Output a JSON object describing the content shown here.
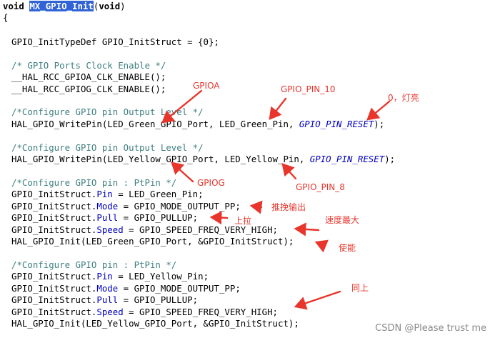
{
  "code": {
    "l1": {
      "kw": "void",
      "fn": "MX_GPIO_Init",
      "open": "(",
      "kw2": "void",
      "close": ")"
    },
    "brace_open": "{",
    "decl": "GPIO_InitTypeDef GPIO_InitStruct = {0};",
    "clock_comment": "/* GPIO Ports Clock Enable */",
    "clock_a": "__HAL_RCC_GPIOA_CLK_ENABLE();",
    "clock_g": "__HAL_RCC_GPIOG_CLK_ENABLE();",
    "out_comment_1": "/*Configure GPIO pin Output Level */",
    "wp1": {
      "pre": "HAL_GPIO_WritePin(LED_Green_GPIO_Port, LED_Green_Pin, ",
      "mac": "GPIO_PIN_RESET",
      "post": ");"
    },
    "out_comment_2": "/*Configure GPIO pin Output Level */",
    "wp2": {
      "pre": "HAL_GPIO_WritePin(LED_Yellow_GPIO_Port, LED_Yellow_Pin, ",
      "mac": "GPIO_PIN_RESET",
      "post": ");"
    },
    "pin_comment_1": "/*Configure GPIO pin : PtPin */",
    "g_pin": {
      "pre": "GPIO_InitStruct.",
      "field": "Pin",
      "post": " = LED_Green_Pin;"
    },
    "g_mode": {
      "pre": "GPIO_InitStruct.",
      "field": "Mode",
      "post": " = GPIO_MODE_OUTPUT_PP;"
    },
    "g_pull": {
      "pre": "GPIO_InitStruct.",
      "field": "Pull",
      "post": " = GPIO_PULLUP;"
    },
    "g_speed": {
      "pre": "GPIO_InitStruct.",
      "field": "Speed",
      "post": " = GPIO_SPEED_FREQ_VERY_HIGH;"
    },
    "g_init": "HAL_GPIO_Init(LED_Green_GPIO_Port, &GPIO_InitStruct);",
    "pin_comment_2": "/*Configure GPIO pin : PtPin */",
    "y_pin": {
      "pre": "GPIO_InitStruct.",
      "field": "Pin",
      "post": " = LED_Yellow_Pin;"
    },
    "y_mode": {
      "pre": "GPIO_InitStruct.",
      "field": "Mode",
      "post": " = GPIO_MODE_OUTPUT_PP;"
    },
    "y_pull": {
      "pre": "GPIO_InitStruct.",
      "field": "Pull",
      "post": " = GPIO_PULLUP;"
    },
    "y_speed": {
      "pre": "GPIO_InitStruct.",
      "field": "Speed",
      "post": " = GPIO_SPEED_FREQ_VERY_HIGH;"
    },
    "y_init": "HAL_GPIO_Init(LED_Yellow_GPIO_Port, &GPIO_InitStruct);"
  },
  "annotations": {
    "gpioa": "GPIOA",
    "gpio_pin_10": "GPIO_PIN_10",
    "zero_on": "0，灯亮",
    "gpiog": "GPIOG",
    "gpio_pin_8": "GPIO_PIN_8",
    "push_pull": "推挽输出",
    "pull_up": "上拉",
    "max_speed": "速度最大",
    "enable": "使能",
    "same_above": "同上"
  },
  "watermark": "CSDN @Please trust me",
  "colors": {
    "highlight": "#2f63d6",
    "comment": "#3f7f7f",
    "field": "#0000c0",
    "annotation": "#e8362c"
  }
}
